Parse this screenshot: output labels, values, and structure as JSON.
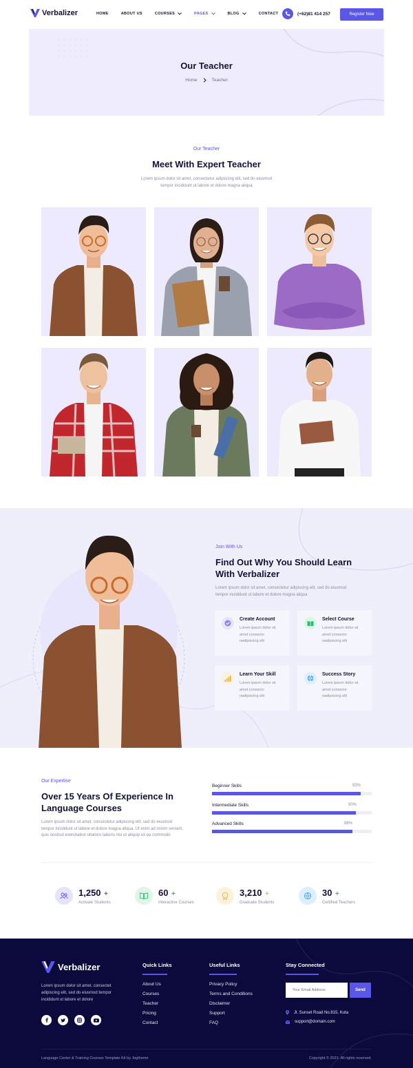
{
  "brand": {
    "name": "Verbalizer",
    "accent": "#5b57e6",
    "dark": "#0c0a3c"
  },
  "nav": {
    "items": [
      {
        "label": "HOME"
      },
      {
        "label": "ABOUT US"
      },
      {
        "label": "COURSES"
      },
      {
        "label": "PAGES"
      },
      {
        "label": "BLOG"
      },
      {
        "label": "CONTACT"
      }
    ],
    "phone": "(+62)81 414 257",
    "register": "Register Now"
  },
  "banner": {
    "title": "Our Teacher",
    "crumb_home": "Home",
    "crumb_current": "Teacher"
  },
  "teachers": {
    "eyebrow": "Our Teacher",
    "title": "Meet With Expert Teacher",
    "desc1": "Lorem ipsum dolor sit amet, consectetur adipiscing elit, sed do eiusmod",
    "desc2": "tempor incididunt ut labore et dolore magna aliqua"
  },
  "join": {
    "eyebrow": "Join With Us",
    "title1": "Find Out Why You Should Learn",
    "title2": "With Verbalizer",
    "desc1": "Lorem ipsum dolor sit amet, consectetur adipiscing elit, sed do eiusmod",
    "desc2": "tempor incididunt ut labore et dolore magna aliqua",
    "features": [
      {
        "title": "Create Account",
        "text": "Lorem ipsum dolor sit amet consecte nadipiscing elit",
        "icon": "check-circle-icon"
      },
      {
        "title": "Select Course",
        "text": "Lorem ipsum dolor sit amet consecte nadipiscing elit",
        "icon": "book-icon"
      },
      {
        "title": "Learn Your Skill",
        "text": "Lorem ipsum dolor sit amet consecte nadipiscing elit",
        "icon": "bar-chart-icon"
      },
      {
        "title": "Success Story",
        "text": "Lorem ipsum dolor sit amet consecte nadipiscing elit",
        "icon": "globe-icon"
      }
    ]
  },
  "expertise": {
    "eyebrow": "Our Expertise",
    "title1": "Over 15 Years Of Experience In",
    "title2": "Language Courses",
    "desc1": "Lorem ipsum dolor sit amet, consectetur adipiscing elit, sed do eiusmod",
    "desc2": "tempor incididunt ut labore et dolore magna aliqua. Ut enim ad minim veniam,",
    "desc3": "quis nostrud exercitation ullamco laboris nisi ut aliquip ex ea commodo",
    "skills": [
      {
        "label": "Beginner Skills",
        "pct": "93%",
        "value": 0.93
      },
      {
        "label": "Intermediate Skills",
        "pct": "90%",
        "value": 0.9
      },
      {
        "label": "Advanced Skills",
        "pct": "88%",
        "value": 0.88
      }
    ]
  },
  "stats": [
    {
      "num": "1,250",
      "label": "Activate Students",
      "color": "#5b57e6"
    },
    {
      "num": "60",
      "label": "Interactive Courses",
      "color": "#2bbd6e"
    },
    {
      "num": "3,210",
      "label": "Graduate Students",
      "color": "#f2b33d"
    },
    {
      "num": "30",
      "label": "Certified Teachers",
      "color": "#4aa3e8"
    }
  ],
  "footer": {
    "brand": "Verbalizer",
    "about1": "Lorem ipsum dolor sit amet, consectet",
    "about2": "adipiscing elit, sed do eiusmod tempor",
    "about3": "incididunt ut labore et dolore",
    "quick_title": "Quick Links",
    "quick": [
      "About Us",
      "Courses",
      "Teacher",
      "Pricing",
      "Contact"
    ],
    "useful_title": "Useful Links",
    "useful": [
      "Privacy Policy",
      "Terms and Conditions",
      "Disclaimer",
      "Support",
      "FAQ"
    ],
    "stay_title": "Stay Connected",
    "email_placeholder": "Your Email Address",
    "send": "Send",
    "address": "Jl. Sunset Road No.815, Kuta",
    "email": "support@domain.com",
    "credit": "Language Center & Training Courses Template Kit by Jegtheme",
    "copyright": "Copyright © 2021. All rights reserved."
  }
}
